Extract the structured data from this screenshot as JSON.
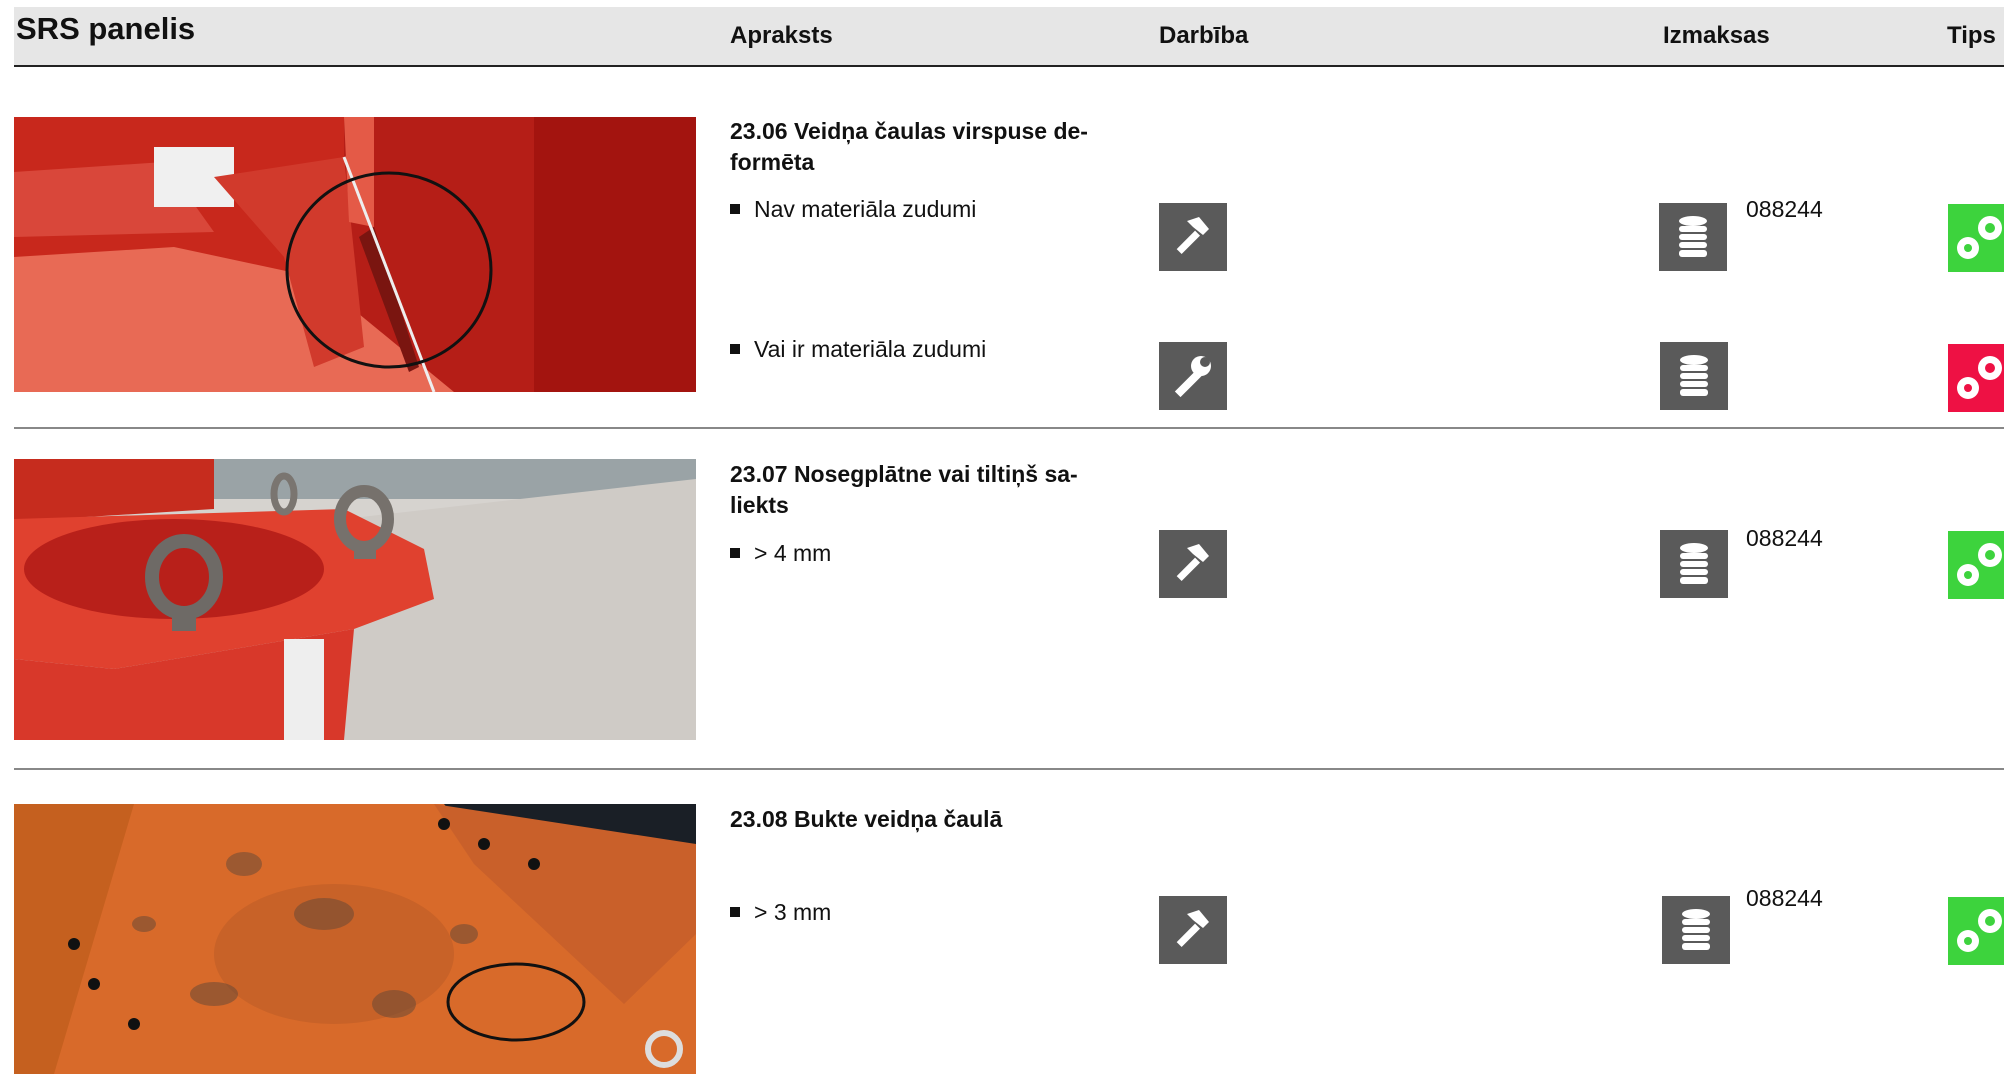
{
  "header": {
    "title": "SRS panelis",
    "columns": {
      "description": "Apraksts",
      "action": "Darbība",
      "cost": "Izmaksas",
      "type": "Tips"
    }
  },
  "items": [
    {
      "title": "23.06 Veidņa čaulas virspuse de-formēta",
      "title_line1": "23.06 Veidņa čaulas virspuse de-",
      "title_line2": "formēta",
      "conditions": [
        {
          "text": "Nav materiāla zudumi",
          "action_icon": "hammer-icon",
          "cost_icon": "coins-icon",
          "cost": "088244",
          "type_color": "green"
        },
        {
          "text": "Vai ir materiāla zudumi",
          "action_icon": "wrench-icon",
          "cost_icon": "coins-icon",
          "cost": "",
          "type_color": "red"
        }
      ]
    },
    {
      "title_line1": "23.07 Nosegplātne vai tiltiņš sa-",
      "title_line2": "liekts",
      "conditions": [
        {
          "text": "> 4 mm",
          "action_icon": "hammer-icon",
          "cost_icon": "coins-icon",
          "cost": "088244",
          "type_color": "green"
        }
      ]
    },
    {
      "title_line1": "23.08 Bukte veidņa čaulā",
      "conditions": [
        {
          "text": "> 3 mm",
          "action_icon": "hammer-icon",
          "cost_icon": "coins-icon",
          "cost": "088244",
          "type_color": "green"
        }
      ]
    }
  ],
  "colors": {
    "green": "#3dd33d",
    "red": "#ee1144",
    "icon_bg": "#5a5a5a",
    "header_bg": "#e6e6e6"
  }
}
